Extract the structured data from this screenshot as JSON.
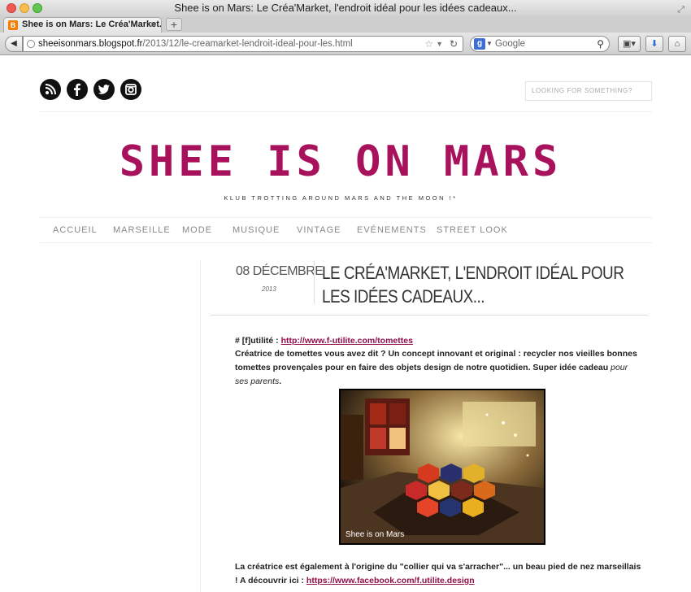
{
  "window": {
    "title": "Shee is on Mars: Le Créa'Market, l'endroit idéal pour les idées cadeaux...",
    "tab_title": "Shee is on Mars: Le Créa'Market...",
    "tab_favicon": "B",
    "tab_close": "×",
    "new_tab": "+"
  },
  "navbar": {
    "url_domain": "sheeisonmars.blogspot.fr",
    "url_path": "/2013/12/le-creamarket-lendroit-ideal-pour-les.html",
    "search_placeholder": "Google",
    "google_badge": "g"
  },
  "blog": {
    "search_placeholder": "LOOKING FOR SOMETHING?",
    "title": "SHEE IS ON MARS",
    "tagline": "KLUB TROTTING AROUND MARS AND THE MOON !*",
    "menu": [
      "ACCUEIL",
      "MARSEILLE",
      "MODE",
      "MUSIQUE",
      "VINTAGE",
      "EVÉNEMENTS",
      "STREET LOOK"
    ]
  },
  "post": {
    "date_day": "08 DÉCEMBRE",
    "date_year": "2013",
    "title": "LE CRÉA'MARKET, L'ENDROIT IDÉAL POUR LES IDÉES CADEAUX...",
    "p1_prefix": "# [f]utilité : ",
    "p1_link": "http://www.f-utilite.com/tomettes",
    "p2_text": "Créatrice de tomettes vous avez dit ? Un concept innovant et original : recycler nos vieilles bonnes tomettes provençales pour en faire des objets design de notre quotidien. Super idée cadeau ",
    "p2_italic": "pour ses parents",
    "p2_end": ".",
    "photo_caption": "Shee is on Mars",
    "p3_text": "La créatrice est également à l'origine du \"collier qui va s'arracher\"... un beau pied de nez marseillais ! A découvrir ici : ",
    "p3_link": "https://www.facebook.com/f.utilite.design"
  },
  "colors": {
    "brand": "#a8125c",
    "link": "#8f0f4b"
  }
}
